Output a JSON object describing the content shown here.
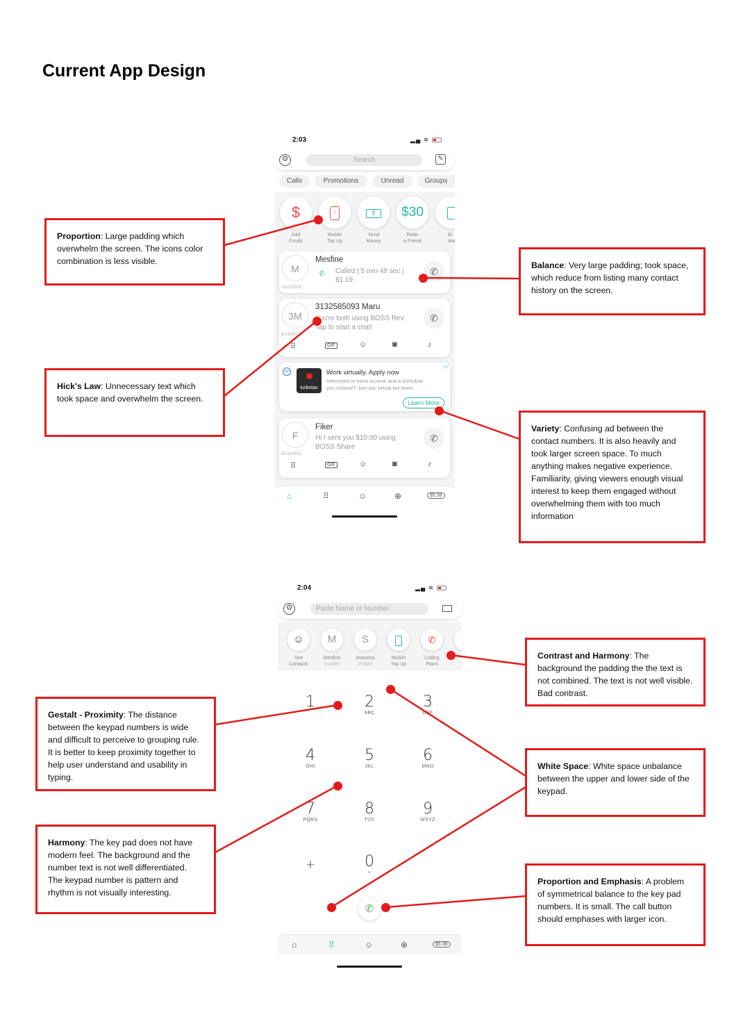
{
  "page": {
    "title": "Current App Design"
  },
  "screen1": {
    "time": "2:03",
    "search_placeholder": "Search",
    "tabs": [
      "Calls",
      "Promotions",
      "Unread",
      "Groups"
    ],
    "quick_actions": [
      {
        "icon": "$",
        "label1": "Add",
        "label2": "Funds"
      },
      {
        "icon": "phone-topup-icon",
        "label1": "Mobile",
        "label2": "Top Up"
      },
      {
        "icon": "money-icon",
        "label1": "Send",
        "label2": "Money"
      },
      {
        "icon": "$30",
        "label1": "Refer",
        "label2": "a Friend"
      },
      {
        "icon": "wallet-icon",
        "label1": "Bi",
        "label2": "Wa"
      }
    ],
    "contacts": [
      {
        "avatar": "M",
        "name": "Mesfine",
        "line1": "Called | 5 min 48 sec |",
        "line2": "$1.19",
        "date": "11/2/2023"
      },
      {
        "avatar": "3M",
        "name": "3132585093 Maru",
        "line1": "You're both using BOSS Rev.",
        "line2": "Tap to start a chat!",
        "date": "9/13/2023"
      },
      {
        "avatar": "F",
        "name": "Fiker",
        "line1": "Hi I sent you $10.00 using",
        "line2": "BOSS Share",
        "date": "9/11/2023"
      }
    ],
    "ad": {
      "badge": "AD",
      "logo": "turbotax",
      "title": "Work virtually. Apply now",
      "body1": "Interested in extra income and a schedule",
      "body2": "you choose? Join our virtual tax team",
      "cta": "Learn More"
    },
    "toolbar_gif": "GIF",
    "balance": "$5.38"
  },
  "screen2": {
    "time": "2:04",
    "search_placeholder": "Paste Name or Number",
    "shortcuts": [
      {
        "icon": "person-icon",
        "label1": "See",
        "label2": "Contacts"
      },
      {
        "icon": "M",
        "label1": "Mesfine",
        "label2": "mobile"
      },
      {
        "icon": "S",
        "label1": "sharama",
        "label2": "mobile"
      },
      {
        "icon": "phone-topup-icon",
        "label1": "Mobile",
        "label2": "Top Up"
      },
      {
        "icon": "calling-plans-icon",
        "label1": "Calling",
        "label2": "Plans"
      }
    ],
    "keys": [
      {
        "d": "1",
        "l": ""
      },
      {
        "d": "2",
        "l": "ABC"
      },
      {
        "d": "3",
        "l": "DEF"
      },
      {
        "d": "4",
        "l": "GHI"
      },
      {
        "d": "5",
        "l": "JKL"
      },
      {
        "d": "6",
        "l": "MNO"
      },
      {
        "d": "7",
        "l": "PQRS"
      },
      {
        "d": "8",
        "l": "TUV"
      },
      {
        "d": "9",
        "l": "WXYZ"
      },
      {
        "d": "+",
        "l": ""
      },
      {
        "d": "0",
        "l": "+"
      }
    ],
    "balance": "$5.38"
  },
  "notes": {
    "proportion": {
      "title": "Proportion",
      "text": ": Large padding which overwhelm  the screen. The icons color combination is less visible."
    },
    "balance": {
      "title": "Balance",
      "text": ": Very large padding; took space, which reduce from listing many contact history on the screen."
    },
    "hicks": {
      "title": "Hick's Law",
      "text": ": Unnecessary text which took space and overwhelm the screen."
    },
    "variety": {
      "title": "Variety",
      "text": ": Confusing ad between the contact numbers. It is also heavily and took larger screen space. To much anything makes negative experience. Familiarity, giving viewers enough visual interest to keep them engaged without overwhelming them with too much information"
    },
    "contrast": {
      "title": "Contrast and Harmony",
      "text": ": The background the padding the the text is not combined. The text is not well visible. Bad contrast."
    },
    "gestalt": {
      "title": "Gestalt - Proximity",
      "text": ": The distance between the keypad numbers is wide and difficult to perceive to grouping rule. It is better to keep proximity together to help user understand and usability in typing."
    },
    "whitespace": {
      "title": "White Space",
      "text": ": White space unbalance between the upper and lower side of the keypad."
    },
    "harmony": {
      "title": "Harmony",
      "text": ": The key pad does not have modern feel. The background and the number text is not well differentiated. The keypad number is pattern and rhythm is not visually interesting."
    },
    "emphasis": {
      "title": "Proportion and Emphasis",
      "text": ": A problem of symmetrical balance to the key pad numbers. It is small. The call button should emphases with larger icon."
    }
  },
  "colors": {
    "accent": "#e31b1b",
    "teal": "#2bb3a3"
  }
}
